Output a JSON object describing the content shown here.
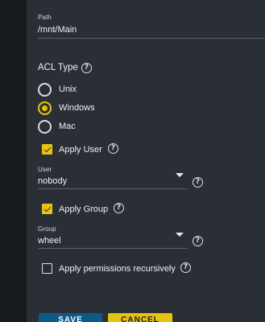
{
  "path": {
    "label": "Path",
    "value": "/mnt/Main"
  },
  "acl_type": {
    "title": "ACL Type",
    "options": [
      "Unix",
      "Windows",
      "Mac"
    ],
    "selected": "Windows"
  },
  "apply_user": {
    "label": "Apply User",
    "checked": true
  },
  "user": {
    "label": "User",
    "value": "nobody"
  },
  "apply_group": {
    "label": "Apply Group",
    "checked": true
  },
  "group": {
    "label": "Group",
    "value": "wheel"
  },
  "recursive": {
    "label": "Apply permissions recursively",
    "checked": false
  },
  "buttons": {
    "save": "SAVE",
    "cancel": "CANCEL"
  },
  "colors": {
    "accent": "#e8c20e",
    "primary": "#0d5a87",
    "panel": "#2a2f35"
  },
  "icons": {
    "help": "help-circle-icon",
    "dropdown": "caret-down-icon"
  }
}
